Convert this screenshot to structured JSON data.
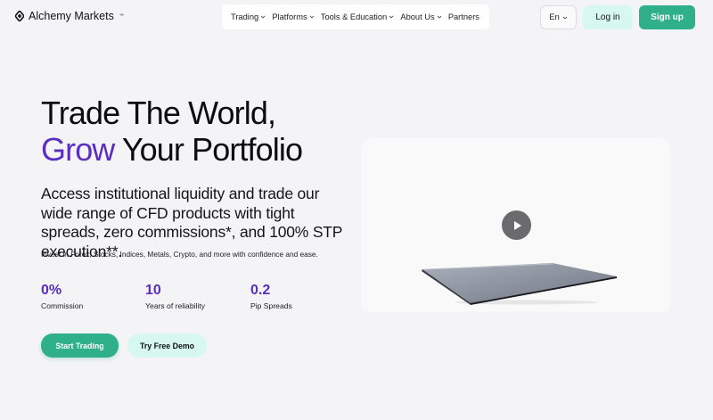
{
  "brand": {
    "name": "Alchemy Markets",
    "trademark": "™"
  },
  "nav": {
    "items": [
      {
        "label": "Trading",
        "has_dropdown": true
      },
      {
        "label": "Platforms",
        "has_dropdown": true
      },
      {
        "label": "Tools & Education",
        "has_dropdown": true
      },
      {
        "label": "About Us",
        "has_dropdown": true
      },
      {
        "label": "Partners",
        "has_dropdown": false
      }
    ]
  },
  "header": {
    "language": "En",
    "login_label": "Log in",
    "signup_label": "Sign up"
  },
  "hero": {
    "title_line1": "Trade The World,",
    "title_highlight": "Grow",
    "title_line2_rest": " Your Portfolio",
    "subheading": "Access institutional liquidity and trade our wide range of CFD products with tight spreads, zero commissions*, and 100% STP execution**.",
    "description": "Invest in Forex, Stocks, Indices, Metals, Crypto, and more with confidence and ease.",
    "stats": [
      {
        "value": "0%",
        "label": "Commission"
      },
      {
        "value": "10",
        "label": "Years of reliability"
      },
      {
        "value": "0.2",
        "label": "Pip Spreads"
      }
    ],
    "primary_cta": "Start Trading",
    "secondary_cta": "Try Free Demo"
  },
  "media": {
    "play_icon": "play-icon",
    "image": "laptop-illustration"
  },
  "colors": {
    "brand_green": "#2fb08a",
    "mint": "#d6f8ef",
    "accent_purple": "#5a2ec0",
    "background": "#f4f4f6"
  }
}
